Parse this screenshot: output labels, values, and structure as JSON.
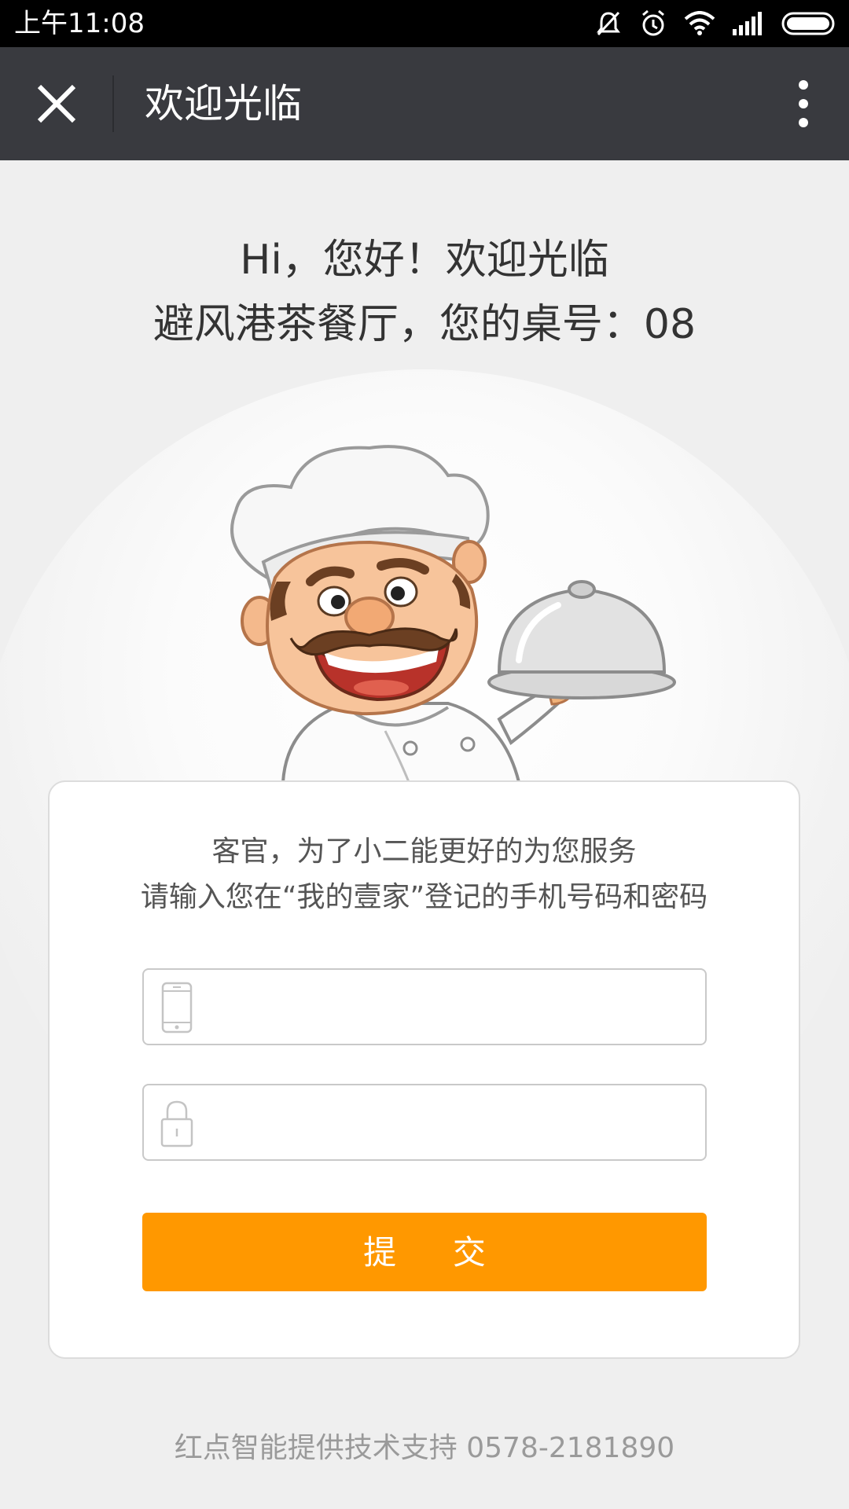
{
  "status_bar": {
    "time": "上午11:08",
    "icons": [
      "mute-icon",
      "alarm-icon",
      "wifi-icon",
      "signal-icon",
      "battery-icon"
    ]
  },
  "nav": {
    "title": "欢迎光临",
    "close_icon": "close-icon",
    "more_icon": "more-vertical-icon",
    "background": "#393a3f"
  },
  "greeting": {
    "line1": "Hi，您好！欢迎光临",
    "line2": "避风港茶餐厅，您的桌号：08"
  },
  "illustration": "chef-holding-cloche",
  "form": {
    "message_line1": "客官，为了小二能更好的为您服务",
    "message_line2": "请输入您在“我的壹家”登记的手机号码和密码",
    "phone_field": {
      "icon": "phone-icon",
      "value": "",
      "placeholder": ""
    },
    "password_field": {
      "icon": "lock-icon",
      "value": "",
      "placeholder": ""
    },
    "submit_label": "提 交",
    "accent_color": "#ff9800"
  },
  "footer": {
    "text": "红点智能提供技术支持  0578-2181890"
  }
}
